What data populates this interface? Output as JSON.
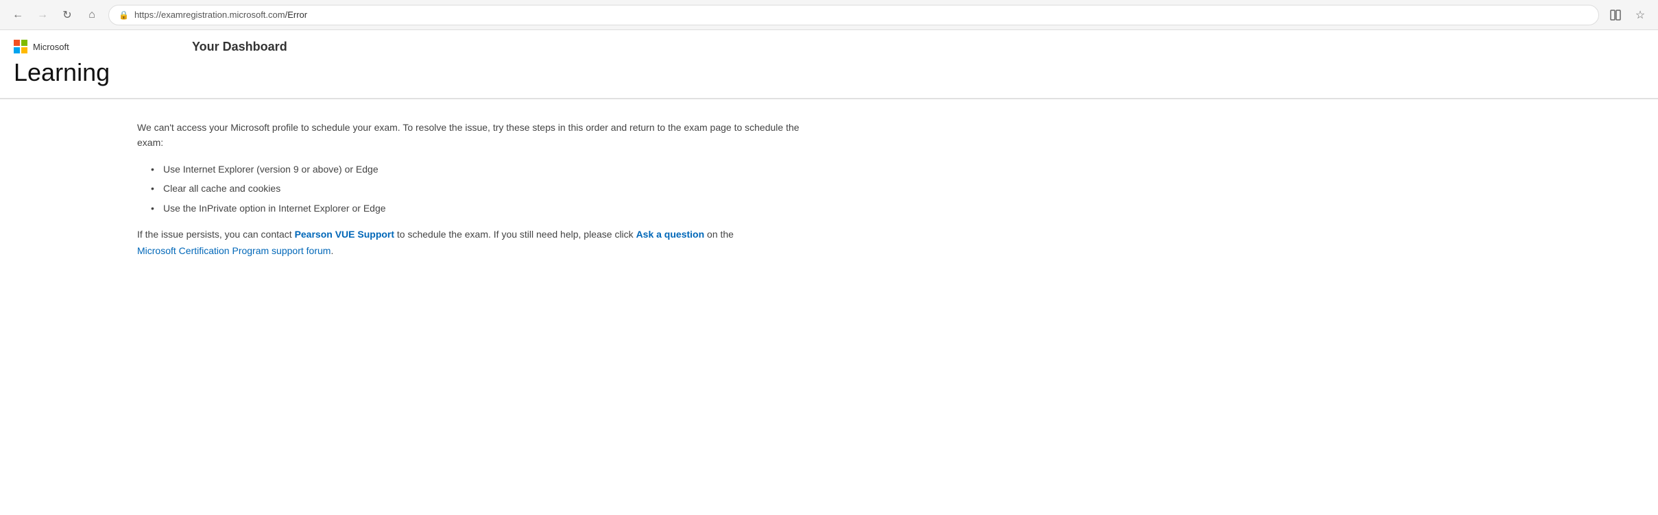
{
  "browser": {
    "url_display": "https://examregistration.microsoft.com/Error",
    "url_base": "https://examregistration.microsoft.com",
    "url_path": "/Error",
    "back_btn": "←",
    "forward_btn": "→",
    "refresh_btn": "↺",
    "home_btn": "⌂"
  },
  "header": {
    "ms_label": "Microsoft",
    "site_title": "Learning",
    "dashboard_title": "Your Dashboard"
  },
  "content": {
    "error_intro": "We can't access your Microsoft profile to schedule your exam. To resolve the issue, try these steps in this order and return to the exam page to schedule the exam:",
    "bullet_items": [
      "Use Internet Explorer (version 9 or above) or Edge",
      "Clear all cache and cookies",
      "Use the InPrivate option in Internet Explorer or Edge"
    ],
    "follow_up_prefix": "If the issue persists, you can contact ",
    "pearson_link_text": "Pearson VUE Support",
    "follow_up_middle": " to schedule the exam. If you still need help, please click ",
    "ask_question_text": "Ask a question",
    "follow_up_suffix": " on the",
    "ms_cert_link_text": "Microsoft Certification Program support forum",
    "follow_up_end": "."
  }
}
